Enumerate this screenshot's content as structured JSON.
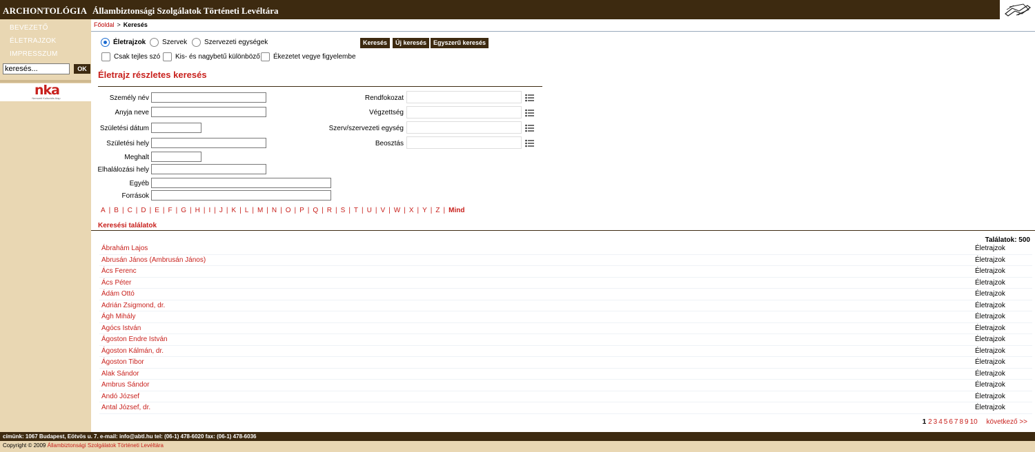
{
  "header": {
    "brand": "ARCHONTOLÓGIA",
    "title": "Állambiztonsági Szolgálatok Történeti Levéltára"
  },
  "sidebar": {
    "nav": [
      "BEVEZETŐ",
      "ÉLETRAJZOK",
      "IMPRESSZUM"
    ],
    "search_value": "keresés...",
    "ok_label": "OK",
    "sponsor_logo": "nka",
    "sponsor_sub": "Nemzeti Kulturális Alap"
  },
  "breadcrumb": {
    "home": "Főoldal",
    "separator": ">",
    "current": "Keresés"
  },
  "options": {
    "radios": [
      {
        "label": "Életrajzok",
        "selected": true
      },
      {
        "label": "Szervek",
        "selected": false
      },
      {
        "label": "Szervezeti egységek",
        "selected": false
      }
    ],
    "checkboxes": [
      "Csak tejles szó",
      "Kis- és nagybetű különböző",
      "Ékezetet vegye figyelembe"
    ],
    "buttons": [
      "Keresés",
      "Új keresés",
      "Egyszerű keresés"
    ]
  },
  "form": {
    "title": "Életrajz részletes keresés",
    "left_labels": [
      "Személy név",
      "Anyja neve",
      "Születési dátum",
      "Születési hely",
      "Meghalt",
      "Elhalálozási hely",
      "Egyéb",
      "Források"
    ],
    "right_labels": [
      "Rendfokozat",
      "Végzettség",
      "Szerv/szervezeti egység",
      "Beosztás"
    ]
  },
  "alphabet": [
    "A",
    "B",
    "C",
    "D",
    "E",
    "F",
    "G",
    "H",
    "I",
    "J",
    "K",
    "L",
    "M",
    "N",
    "O",
    "P",
    "Q",
    "R",
    "S",
    "T",
    "U",
    "V",
    "W",
    "X",
    "Y",
    "Z"
  ],
  "alphabet_all": "Mind",
  "results": {
    "title": "Keresési találatok",
    "count_text": "Találatok: 500",
    "rows": [
      {
        "name": "Ábrahám Lajos",
        "type": "Életrajzok"
      },
      {
        "name": "Abrusán János (Ambrusán János)",
        "type": "Életrajzok"
      },
      {
        "name": "Ács Ferenc",
        "type": "Életrajzok"
      },
      {
        "name": "Ács Péter",
        "type": "Életrajzok"
      },
      {
        "name": "Ádám Ottó",
        "type": "Életrajzok"
      },
      {
        "name": "Adrián Zsigmond, dr.",
        "type": "Életrajzok"
      },
      {
        "name": "Ágh Mihály",
        "type": "Életrajzok"
      },
      {
        "name": "Agócs István",
        "type": "Életrajzok"
      },
      {
        "name": "Ágoston Endre István",
        "type": "Életrajzok"
      },
      {
        "name": "Ágoston Kálmán, dr.",
        "type": "Életrajzok"
      },
      {
        "name": "Ágoston Tibor",
        "type": "Életrajzok"
      },
      {
        "name": "Alak Sándor",
        "type": "Életrajzok"
      },
      {
        "name": "Ambrus Sándor",
        "type": "Életrajzok"
      },
      {
        "name": "Andó József",
        "type": "Életrajzok"
      },
      {
        "name": "Antal József, dr.",
        "type": "Életrajzok"
      }
    ]
  },
  "pagination": {
    "current": "1",
    "pages": [
      "2",
      "3",
      "4",
      "5",
      "6",
      "7",
      "8",
      "9",
      "10"
    ],
    "next": "következő >>"
  },
  "footer": {
    "address": "címünk: 1067 Budapest, Eötvös u. 7. e-mail: info@abtl.hu tel: (06-1) 478-6020 fax: (06-1) 478-6036",
    "copyright": "Copyright © 2009",
    "org": "Állambiztonsági Szolgálatok Történeti Levéltára"
  },
  "colors": {
    "brown": "#3d2a10",
    "beige": "#e9d7b3",
    "red": "#c8201c"
  }
}
